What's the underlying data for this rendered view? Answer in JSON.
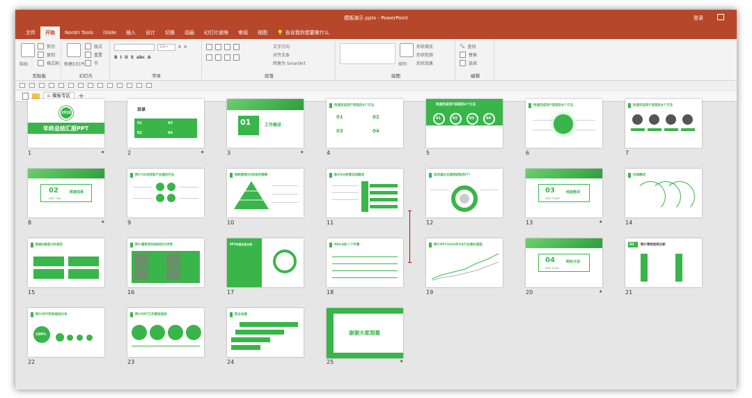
{
  "window": {
    "title": "模板演示.pptx  -  PowerPoint",
    "login": "登录"
  },
  "tabs": [
    "文件",
    "开始",
    "Nordri Tools",
    "iSlide",
    "插入",
    "设计",
    "切换",
    "动画",
    "幻灯片放映",
    "审阅",
    "视图"
  ],
  "tell_me": "告诉我你想要做什么",
  "ribbon": {
    "clipboard": {
      "label": "剪贴板",
      "paste": "粘贴",
      "cut": "剪切",
      "copy": "复制",
      "format_painter": "格式刷"
    },
    "slides": {
      "label": "幻灯片",
      "new_slide": "新建幻灯片",
      "layout": "版式",
      "reset": "重置",
      "section": "节"
    },
    "font": {
      "label": "字体",
      "size": "24+"
    },
    "paragraph": {
      "label": "段落",
      "text_direction": "文字方向",
      "align_text": "对齐文本",
      "smartart": "转换为 SmartArt"
    },
    "drawing": {
      "label": "绘图",
      "arrange": "排列",
      "quick_styles": "快速样式",
      "shape_fill": "形状填充",
      "shape_outline": "形状轮廓",
      "shape_effects": "形状效果"
    },
    "editing": {
      "label": "编辑",
      "find": "查找",
      "replace": "替换",
      "select": "选择"
    }
  },
  "doc_tab": "模板专区",
  "slides": [
    {
      "n": "1",
      "star": true,
      "title": "年终总结汇报PPT",
      "year": "2018"
    },
    {
      "n": "2",
      "star": true,
      "title": "目录",
      "items": [
        "01",
        "02",
        "03",
        "04"
      ]
    },
    {
      "n": "3",
      "star": true,
      "num": "01",
      "title": "工作概述"
    },
    {
      "n": "4",
      "title": "快速完成用户获取的4个方法",
      "items": [
        "01",
        "02",
        "03",
        "04"
      ]
    },
    {
      "n": "5",
      "title": "快速完成用户获取的4个方法",
      "items": [
        "01",
        "02",
        "03",
        "04"
      ]
    },
    {
      "n": "6",
      "title": "快速完成用户获取的4个方法"
    },
    {
      "n": "7",
      "title": "快速完成用户获取的4个方法"
    },
    {
      "n": "8",
      "star": true,
      "num": "02",
      "title": "数据成果",
      "sub": "PART TWO"
    },
    {
      "n": "9",
      "title": "荆少XX司获取产业链的行业"
    },
    {
      "n": "10",
      "title": "网络营销XX阶段的策略"
    },
    {
      "n": "11",
      "title": "新兴XX经营活动概述"
    },
    {
      "n": "12",
      "title": "如何通过互联网获取用户?"
    },
    {
      "n": "13",
      "star": true,
      "num": "03",
      "title": "经验教训",
      "sub": "PART THREE"
    },
    {
      "n": "14",
      "title": "内容概述"
    },
    {
      "n": "15",
      "title": "联想4维度分析报告"
    },
    {
      "n": "16",
      "title": "荆少建筑项目结构四大优势"
    },
    {
      "n": "17",
      "title": "PPT年度业务分析"
    },
    {
      "n": "18",
      "title": "PDCA的八个步骤"
    },
    {
      "n": "19",
      "title": "荆少PPT2018年XX行业增长速度"
    },
    {
      "n": "20",
      "star": true,
      "num": "04",
      "title": "明年计划",
      "sub": "PART FOUR"
    },
    {
      "n": "21",
      "title": "荆少等性别的分析",
      "num": "01"
    },
    {
      "n": "22",
      "title": "荆少PPT阶段规划分布",
      "pct": "100%"
    },
    {
      "n": "23",
      "title": "荆少PPT工作展览规划"
    },
    {
      "n": "24",
      "title": "职业发展"
    },
    {
      "n": "25",
      "star": true,
      "title": "谢谢大家观看"
    }
  ],
  "colors": {
    "accent": "#39b54a",
    "titlebar": "#b7472a"
  }
}
